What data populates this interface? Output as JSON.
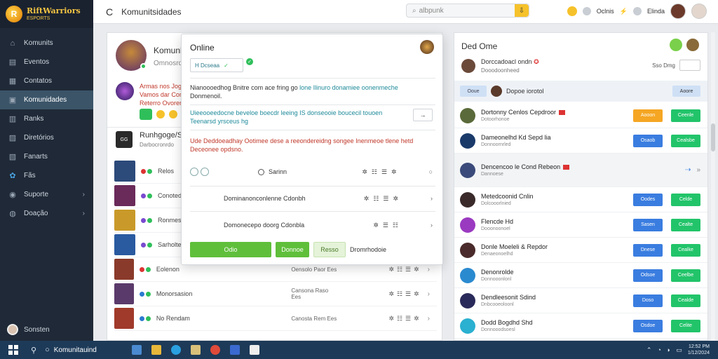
{
  "sidebar": {
    "logo_title": "RiftWarriors",
    "logo_sub": "ESPORTS",
    "items": [
      {
        "label": "Komunits",
        "icon": "home-icon"
      },
      {
        "label": "Eventos",
        "icon": "calendar-icon"
      },
      {
        "label": "Contatos",
        "icon": "contacts-icon"
      },
      {
        "label": "Komunidades",
        "icon": "community-icon",
        "active": true
      },
      {
        "label": "Ranks",
        "icon": "rank-icon"
      },
      {
        "label": "Diretórios",
        "icon": "folder-icon"
      },
      {
        "label": "Fanarts",
        "icon": "image-icon"
      },
      {
        "label": "Fãs",
        "icon": "fans-icon"
      },
      {
        "label": "Suporte",
        "icon": "support-icon",
        "chevron": true
      },
      {
        "label": "Doação",
        "icon": "donate-icon",
        "chevron": true
      }
    ],
    "user_name": "Sonsten"
  },
  "topbar": {
    "back": "C",
    "title": "Komunitsidades",
    "search_placeholder": "albpunk",
    "right_1": "Oclnis",
    "right_2": "Elinda"
  },
  "left_panel": {
    "profile_name": "Komunhe",
    "profile_sub": "Omnosrdo",
    "post_lines": [
      "Armas nos Jogos",
      "Vamos dar Contra",
      "Reterro Ovorer"
    ],
    "group_name": "Runhgoge/Sfdt",
    "group_sub": "Darbocronrdo",
    "group_icon": "GG",
    "rows": [
      {
        "name": "Relos",
        "mid": "",
        "color": "#2c4a7a"
      },
      {
        "name": "Conoteds",
        "mid": "",
        "color": "#6a2a5a"
      },
      {
        "name": "Ronmestog",
        "mid": "",
        "color": "#c99a2a"
      },
      {
        "name": "Sarholte",
        "mid": "",
        "color": "#2a5aa0"
      },
      {
        "name": "Eolenon",
        "mid": "Oensolo Paor Ees",
        "color": "#8a3a2a"
      },
      {
        "name": "Monorsasion",
        "mid": "Cansona Raso Ees",
        "color": "#5a3a6a"
      },
      {
        "name": "No Rendam",
        "mid": "Canosta Rem Ees",
        "color": "#a03a2a"
      }
    ]
  },
  "modal": {
    "title": "Online",
    "field": "H Dcseaa",
    "text1_a": "Nianoooedhog Bnitre com ace fring go",
    "text1_b": "lone Ilinuro donamiee oonenmeche",
    "text1_c": "Donmenoil.",
    "text2": "Uieeooeedocne beveloe boecdr leeing IS donseooie boucecil touoen Teenarsd yrsceus hg",
    "arrow": "→",
    "text3": "Ude Deddoeadhay Ootimee dese a reeondereidng songee Inenmeoe tlene hetd Deceonee opdsno.",
    "row1_label": "Sarinn",
    "row2_label": "Dominanonconlenne Cdonbh",
    "row3_label": "Domonecepo doorg Cdonbla",
    "btn1": "Odio",
    "btn2": "Donnoe",
    "btn3": "Resso",
    "btn4": "Dromrhodoie"
  },
  "right_panel": {
    "title": "Ded Ome",
    "user_name": "Dorccadoacl ondn",
    "user_sub": "Dooodoonheed",
    "sort": "Sso Dmg",
    "filter_chip": "Ooue",
    "filter_text": "Dopoe iorotol",
    "filter_sel": "Aoore",
    "items": [
      {
        "name": "Dortonny Cenlos Cepdroor",
        "sub": "Dotoorhonoe",
        "flag": true,
        "color": "#5a6a3a",
        "btns": [
          "Aooon",
          "Ceenle"
        ],
        "b1": "bo"
      },
      {
        "name": "Dameonelhd Kd Sepd lia",
        "sub": "Donnoornrled",
        "flag": false,
        "color": "#1a3a6a",
        "btns": [
          "Osaob",
          "Cealsbe"
        ],
        "b1": "bb"
      },
      {
        "name": "Dencencoo le Cond Rebeon",
        "sub": "Dannoese",
        "flag": true,
        "color": "#3a4a7a",
        "btns": [],
        "b1": "bb",
        "highlight": true
      },
      {
        "name": "Metedcoonid Cnlin",
        "sub": "Dolcooorlnied",
        "flag": false,
        "color": "#3a2a2a",
        "btns": [
          "Oodes",
          "Celde"
        ],
        "b1": "bb"
      },
      {
        "name": "Flencde Hd",
        "sub": "Dooonoonoel",
        "flag": false,
        "color": "#9a3ac0",
        "btns": [
          "Sasen",
          "Cealte"
        ],
        "b1": "bb"
      },
      {
        "name": "Donle Moeleli & Repdor",
        "sub": "Denaeonoelhd",
        "flag": false,
        "color": "#4a2a2a",
        "btns": [
          "Dnese",
          "Cealke"
        ],
        "b1": "bb"
      },
      {
        "name": "Denonrolde",
        "sub": "Donnooonlonl",
        "flag": false,
        "color": "#2a8ad0",
        "btns": [
          "Odsoe",
          "Ceelbe"
        ],
        "b1": "bb"
      },
      {
        "name": "Dendleesonit Sdind",
        "sub": "Dnbcooeoloonl",
        "flag": false,
        "color": "#2a2a5a",
        "btns": [
          "Doso",
          "Cealde"
        ],
        "b1": "bb"
      },
      {
        "name": "Dodd Bogdhd Shd",
        "sub": "Donnooodsoesl",
        "flag": false,
        "color": "#2ab0d0",
        "btns": [
          "Osdoe",
          "Celite"
        ],
        "b1": "bb"
      }
    ]
  },
  "taskbar": {
    "search_label": "Komunitauind",
    "clock_time": "12:52 PM",
    "clock_date": "1/12/2024"
  },
  "colors": {
    "sidebar_bg": "#1f2937",
    "active_item": "#3b5468",
    "accent_green": "#5fbf3a",
    "blue_button": "#3a7de0",
    "green_button": "#22c46a",
    "orange_button": "#f5a623",
    "taskbar": "#1d3a58"
  }
}
